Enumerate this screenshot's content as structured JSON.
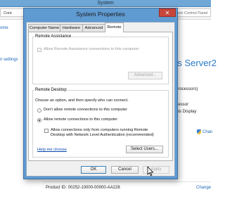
{
  "background_window": {
    "title": "System",
    "address_text": "Cont",
    "search_placeholder": "Search Control Panel",
    "left_links": {
      "home": "ome",
      "settings": "n settings"
    },
    "windows_server_text": "ws Server2",
    "processors_text": "2 processors)",
    "processor_text": "rocessor",
    "display_text": "r this Display",
    "change_link_1": "Chan",
    "change_link_2": "Change",
    "product_id": "Product ID: 00252-10000-00000-AA228"
  },
  "dialog": {
    "title": "System Properties",
    "close_glyph": "✕",
    "tabs": [
      {
        "label": "Computer Name"
      },
      {
        "label": "Hardware"
      },
      {
        "label": "Advanced"
      },
      {
        "label": "Remote"
      }
    ],
    "remote_assistance": {
      "group_label": "Remote Assistance",
      "checkbox_label": "Allow Remote Assistance connections to this computer",
      "checkbox_checked": false,
      "advanced_button": "Advanced..."
    },
    "remote_desktop": {
      "group_label": "Remote Desktop",
      "instructions": "Choose an option, and then specify who can connect.",
      "option_dont_allow": "Don't allow remote connections to this computer",
      "option_allow": "Allow remote connections to this computer",
      "selected_option": "allow",
      "nla_label_line1": "Allow connections only from computers running Remote",
      "nla_label_line2": "Desktop with Network Level Authentication (recommended)",
      "nla_checked": false,
      "help_link": "Help me choose",
      "select_users_button": "Select Users..."
    },
    "buttons": {
      "ok": "OK",
      "cancel": "Cancel",
      "apply": "Apply"
    }
  },
  "colors": {
    "dialog_frame": "#5f9ad0",
    "close_button": "#c7463a",
    "link": "#0645ad",
    "windows_server_text": "#2b79c8"
  }
}
